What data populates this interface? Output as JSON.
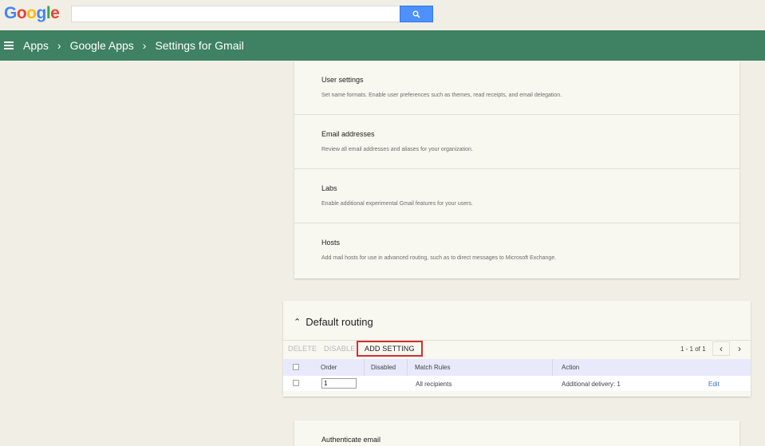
{
  "header": {
    "logo_letters": [
      "G",
      "o",
      "o",
      "g",
      "l",
      "e"
    ],
    "search_placeholder": "",
    "search_icon": "search-icon"
  },
  "nav": {
    "menu_icon": "hamburger-menu-icon",
    "breadcrumbs": [
      "Apps",
      "Google Apps",
      "Settings for Gmail"
    ],
    "separator": "›"
  },
  "settings": [
    {
      "title": "User settings",
      "description": "Set name formats. Enable user preferences such as themes, read receipts, and email delegation."
    },
    {
      "title": "Email addresses",
      "description": "Review all email addresses and aliases for your organization."
    },
    {
      "title": "Labs",
      "description": "Enable additional experimental Gmail features for your users."
    },
    {
      "title": "Hosts",
      "description": "Add mail hosts for use in advanced routing, such as to direct messages to Microsoft Exchange."
    }
  ],
  "routing": {
    "title": "Default routing",
    "toolbar": {
      "delete": "DELETE",
      "disable": "DISABLE",
      "add_setting": "ADD SETTING",
      "pager": "1 - 1 of 1",
      "prev": "‹",
      "next": "›"
    },
    "columns": [
      "Order",
      "Disabled",
      "Match Rules",
      "Action"
    ],
    "rows": [
      {
        "order": "1",
        "disabled": "",
        "match_rules": "All recipients",
        "action": "Additional delivery: 1",
        "edit": "Edit"
      }
    ]
  },
  "auth": {
    "title": "Authenticate email"
  },
  "colors": {
    "nav_green": "#3f8163",
    "background": "#f1efe5",
    "search_blue": "#4d90fe",
    "highlight_red": "#d32f2f",
    "link_blue": "#3b73c4"
  }
}
